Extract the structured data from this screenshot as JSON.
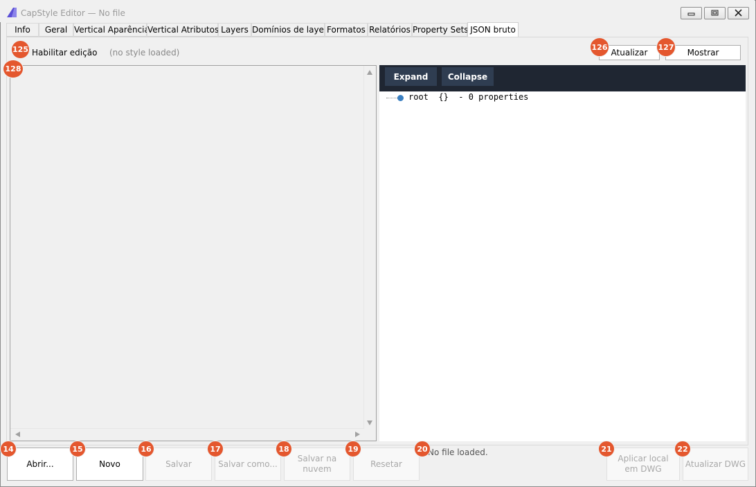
{
  "window": {
    "title": "CapStyle Editor — No file"
  },
  "tabs": [
    {
      "label": "Info"
    },
    {
      "label": "Geral"
    },
    {
      "label": "Vertical Aparência"
    },
    {
      "label": "Vertical Atributos"
    },
    {
      "label": "Layers"
    },
    {
      "label": "Domínios de layer"
    },
    {
      "label": "Formatos"
    },
    {
      "label": "Relatórios"
    },
    {
      "label": "Property Sets"
    },
    {
      "label": "JSON bruto"
    }
  ],
  "json_tab": {
    "enable_edit_label": "Habilitar edição",
    "style_status": "(no style loaded)",
    "refresh_label": "Atualizar",
    "show_label": "Mostrar",
    "expand_label": "Expand",
    "collapse_label": "Collapse",
    "tree_root": "root  {}  - 0 properties"
  },
  "bottom": {
    "open_label": "Abrir...",
    "new_label": "Novo",
    "save_label": "Salvar",
    "save_as_label": "Salvar como...",
    "save_cloud_label": "Salvar na nuvem",
    "reset_label": "Resetar",
    "file_status": "No file loaded.",
    "apply_dwg_label": "Aplicar local em DWG",
    "update_dwg_label": "Atualizar DWG"
  },
  "badges": {
    "enable_edit": "125",
    "refresh": "126",
    "show": "127",
    "editor": "128",
    "open": "14",
    "new": "15",
    "save": "16",
    "save_as": "17",
    "save_cloud": "18",
    "reset": "19",
    "status": "20",
    "apply_dwg": "21",
    "update_dwg": "22"
  },
  "colors": {
    "badge": "#e4572e",
    "viewer_toolbar": "#1f2632",
    "viewer_button": "#2f3d51",
    "tree_dot": "#3a7fc1"
  }
}
